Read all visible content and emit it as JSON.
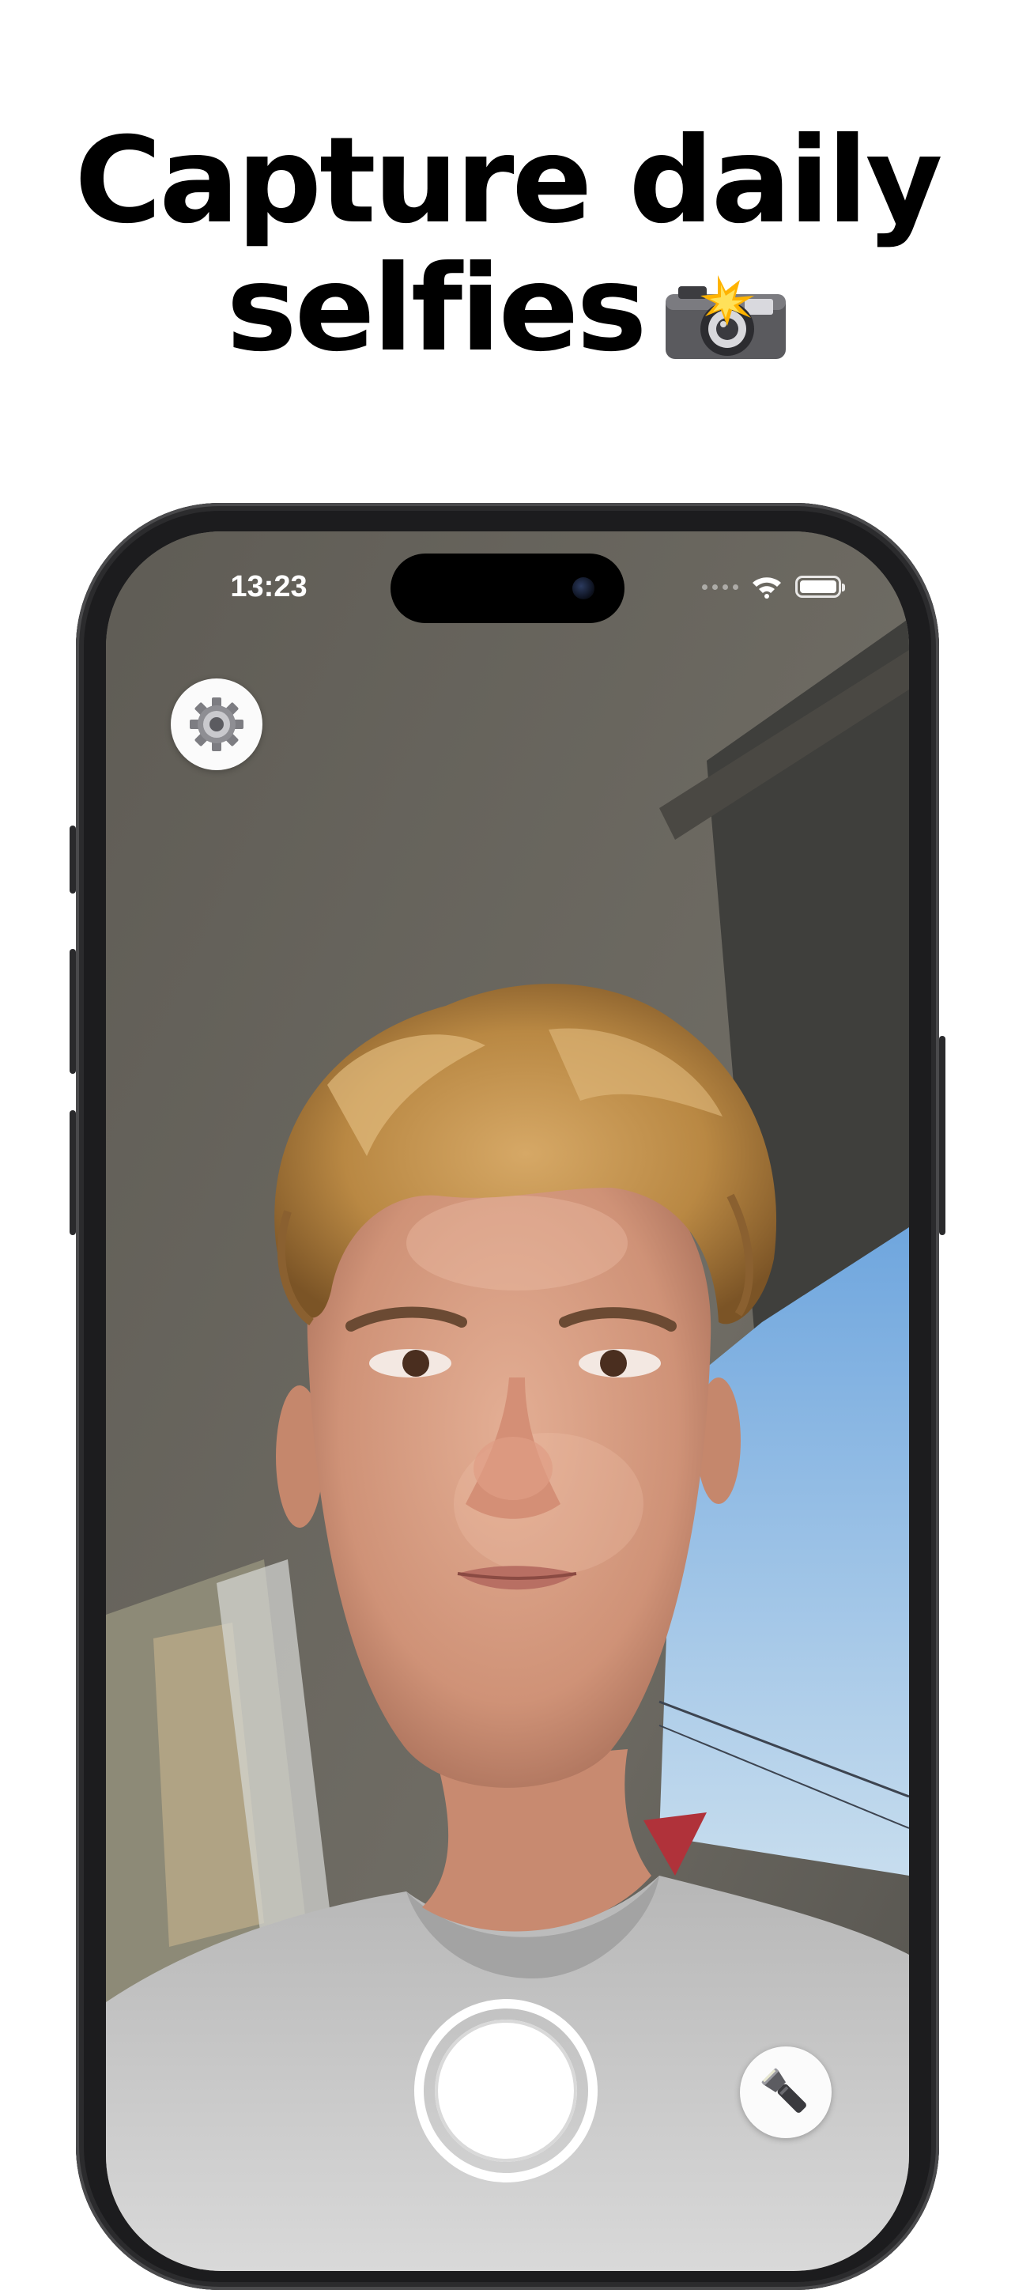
{
  "headline": {
    "line1": "Capture daily",
    "line2": "selfies",
    "emoji_icon": "camera-with-flash-icon"
  },
  "status_bar": {
    "time": "13:23",
    "icons": [
      "signal-dots-icon",
      "wifi-icon",
      "battery-icon"
    ],
    "battery_level": 1.0
  },
  "controls": {
    "settings_icon": "gear-icon",
    "shutter_icon": "shutter-icon",
    "torch_icon": "flashlight-icon"
  },
  "colors": {
    "background": "#ffffff",
    "headline": "#000000",
    "phone_frame": "#1c1c1e",
    "control_fill": "#fbfbfb"
  }
}
